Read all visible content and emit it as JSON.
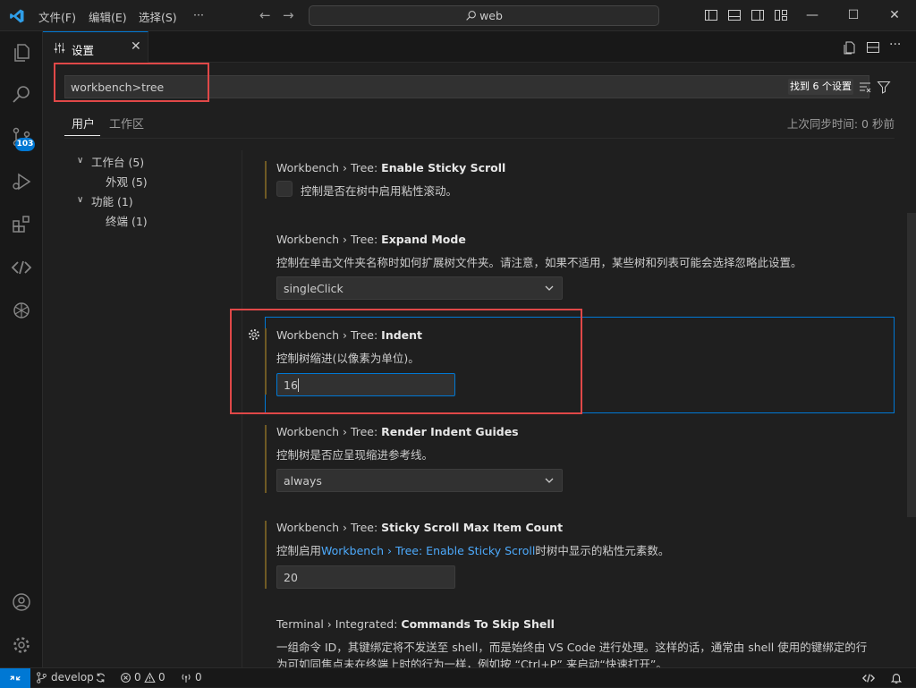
{
  "menu": {
    "file": "文件(F)",
    "edit": "编辑(E)",
    "select": "选择(S)",
    "more": "···"
  },
  "nav": {
    "back": "←",
    "forward": "→"
  },
  "command_center": {
    "text": "web"
  },
  "window": {
    "minimize": "—",
    "maximize": "☐",
    "close": "✕"
  },
  "activity": {
    "source_control_badge": "103"
  },
  "tab": {
    "label": "设置",
    "close": "✕"
  },
  "search": {
    "value": "workbench>tree",
    "found": "找到 6 个设置"
  },
  "scope_tabs": {
    "user": "用户",
    "workspace": "工作区"
  },
  "sync_status": "上次同步时间: 0 秒前",
  "toc": [
    {
      "label": "工作台 (5)",
      "chev": "∨"
    },
    {
      "label": "外观 (5)"
    },
    {
      "label": "功能 (1)",
      "chev": "∨"
    },
    {
      "label": "终端 (1)"
    }
  ],
  "settings": [
    {
      "prefix": "Workbench › Tree: ",
      "name": "Enable Sticky Scroll",
      "desc": "控制是否在树中启用粘性滚动。",
      "checked": false
    },
    {
      "prefix": "Workbench › Tree: ",
      "name": "Expand Mode",
      "desc": "控制在单击文件夹名称时如何扩展树文件夹。请注意，如果不适用，某些树和列表可能会选择忽略此设置。",
      "value": "singleClick"
    },
    {
      "prefix": "Workbench › Tree: ",
      "name": "Indent",
      "desc": "控制树缩进(以像素为单位)。",
      "value": "16"
    },
    {
      "prefix": "Workbench › Tree: ",
      "name": "Render Indent Guides",
      "desc": "控制树是否应呈现缩进参考线。",
      "value": "always"
    },
    {
      "prefix": "Workbench › Tree: ",
      "name": "Sticky Scroll Max Item Count",
      "desc_pre": "控制启用",
      "desc_link": "Workbench › Tree: Enable Sticky Scroll",
      "desc_post": "时树中显示的粘性元素数。",
      "value": "20"
    },
    {
      "prefix": "Terminal › Integrated: ",
      "name": "Commands To Skip Shell",
      "desc": "一组命令 ID，其键绑定将不发送至 shell，而是始终由 VS Code 进行处理。这样的话，通常由 shell 使用的键绑定的行",
      "desc2": "为可如同焦点未在终端上时的行为一样，例如按 “Ctrl+P” 来启动“快速打开”。"
    }
  ],
  "status": {
    "branch": "develop",
    "errors": "0",
    "warnings": "0",
    "ports": "0"
  }
}
